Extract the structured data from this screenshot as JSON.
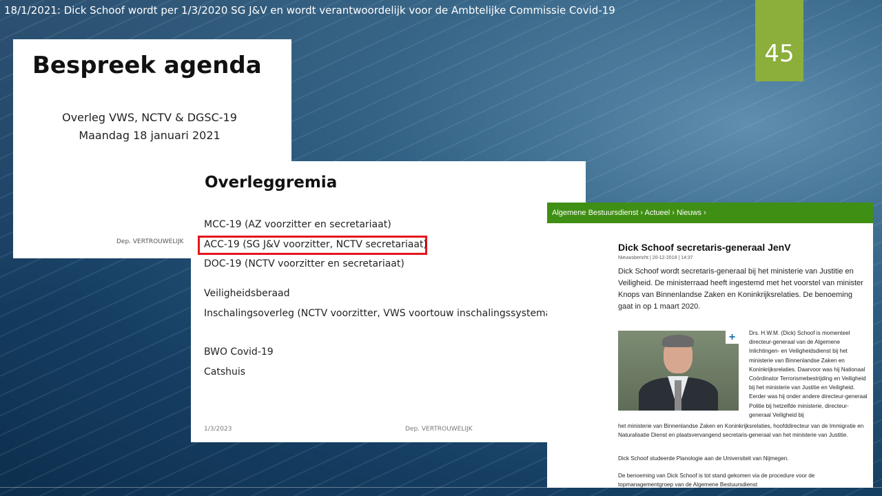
{
  "slide": {
    "title": "18/1/2021: Dick Schoof wordt per 1/3/2020 SG J&V en wordt verantwoordelijk voor de Ambtelijke Commissie Covid-19",
    "page_number": "45",
    "accent_color": "#8cae3b"
  },
  "agenda_card": {
    "heading": "Bespreek agenda",
    "line1": "Overleg VWS, NCTV & DGSC-19",
    "line2": "Maandag 18 januari 2021",
    "footer": "Dep. VERTROUWELIJK"
  },
  "gremia_card": {
    "heading": "Overleggremia",
    "items": [
      "MCC-19 (AZ voorzitter en secretariaat)",
      "ACC-19 (SG J&V voorzitter, NCTV secretariaat)",
      "DOC-19 (NCTV voorzitter en secretariaat)",
      "Veiligheidsberaad",
      "Inschalingsoverleg (NCTV voorzitter, VWS voortouw inschalingssystematie",
      "BWO Covid-19",
      "Catshuis"
    ],
    "highlight_color": "#e4151d",
    "footer_date": "1/3/2023",
    "footer_label": "Dep. VERTROUWELIJK"
  },
  "news_card": {
    "breadcrumb": "Algemene Bestuursdienst  ›  Actueel  ›  Nieuws  ›",
    "brand_color": "#3f8f14",
    "headline": "Dick Schoof secretaris-generaal JenV",
    "meta": "Nieuwsbericht | 20-12-2019 | 14:37",
    "lead": "Dick Schoof wordt secretaris-generaal bij het ministerie van Justitie en Veiligheid. De ministerraad heeft ingestemd met het voorstel van minister Knops van Binnenlandse Zaken en Koninkrijksrelaties. De benoeming gaat in op 1 maart 2020.",
    "bio_side": "Drs. H.W.M. (Dick) Schoof is momenteel directeur-generaal van de Algemene Inlichtingen- en Veiligheidsdienst bij het ministerie van Binnenlandse Zaken en Koninkrijksrelaties. Daarvoor was hij Nationaal Coördinator Terrorismebestrijding en Veiligheid bij het ministerie van Justitie en Veiligheid. Eerder was hij onder andere directeur-generaal Politie bij hetzelfde ministerie, directeur-generaal Veiligheid bij",
    "bio_rest": "het ministerie van Binnenlandse Zaken en Koninkrijksrelaties, hoofddirecteur van de Immigratie en Naturalisatie Dienst en plaatsvervangend secretaris-generaal van het ministerie van Justitie.",
    "para2": "Dick Schoof studeerde Planologie aan de Universiteit van Nijmegen.",
    "para3": "De benoeming van Dick Schoof is tot stand gekomen via de procedure voor de topmanagementgroep van de Algemene Bestuursdienst",
    "photo_icon": "portrait-photo",
    "enlarge_icon": "plus-icon",
    "enlarge_symbol": "+"
  }
}
